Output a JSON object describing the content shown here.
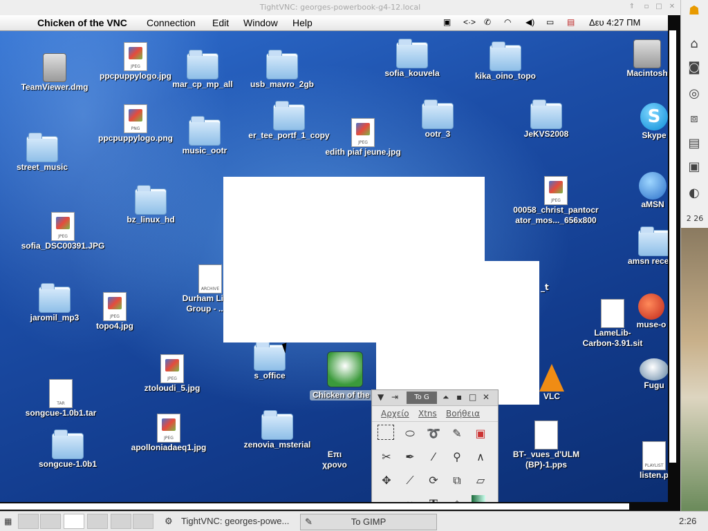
{
  "window": {
    "title": "TightVNC: georges-powerbook-g4-12.local"
  },
  "menubar": {
    "app_name": "Chicken of the VNC",
    "items": [
      "Connection",
      "Edit",
      "Window",
      "Help"
    ],
    "clock": "Δευ 4:27 ΠΜ"
  },
  "desktop_icons": [
    {
      "label": "TeamViewer.dmg"
    },
    {
      "label": "ppcpuppylogo.jpg",
      "badge": "JPEG"
    },
    {
      "label": "mar_cp_mp_all"
    },
    {
      "label": "usb_mavro_2gb"
    },
    {
      "label": "sofia_kouvela"
    },
    {
      "label": "kika_oino_topo"
    },
    {
      "label": "Macintosh"
    },
    {
      "label": "ppcpuppylogo.png",
      "badge": "PNG"
    },
    {
      "label": "music_ootr"
    },
    {
      "label": "er_tee_portf_1_copy"
    },
    {
      "label": "edith piaf jeune.jpg",
      "badge": "JPEG"
    },
    {
      "label": "ootr_3"
    },
    {
      "label": "JeKVS2008"
    },
    {
      "label": "Skype"
    },
    {
      "label": "street_music"
    },
    {
      "label": "bz_linux_hd"
    },
    {
      "label": "00058_christ_pantocr",
      "label2": "ator_mos..._656x800",
      "badge": "JPEG"
    },
    {
      "label": "aMSN"
    },
    {
      "label": "sofia_DSC00391.JPG",
      "badge": "JPEG"
    },
    {
      "label": "Durham Linux",
      "label2": "Group - ...Pr",
      "badge": "ARCHIVE"
    },
    {
      "label": "amsn receive"
    },
    {
      "label": "jaromil_mp3"
    },
    {
      "label": "topo4.jpg",
      "badge": "JPEG"
    },
    {
      "label": "LameLib-",
      "label2": "Carbon-3.91.sit"
    },
    {
      "label": "muse-o"
    },
    {
      "label": "s_office"
    },
    {
      "label": "Chicken of the V"
    },
    {
      "label": "Fugu"
    },
    {
      "label": "songcue-1.0b1.tar",
      "badge": "TAR"
    },
    {
      "label": "ztoloudi_5.jpg",
      "badge": "JPEG"
    },
    {
      "label": "VLC"
    },
    {
      "label": "songcue-1.0b1"
    },
    {
      "label": "apolloniadaeq1.jpg",
      "badge": "JPEG"
    },
    {
      "label": "zenovia_msterial"
    },
    {
      "label": "Επι",
      "label2": "χρονο"
    },
    {
      "label": "BT-_vues_d'ULM",
      "label2": "(BP)-1.pps"
    },
    {
      "label": "listen.p",
      "badge": "PLAYLIST"
    },
    {
      "label": "_t"
    }
  ],
  "gimp": {
    "title_button": "To G",
    "menu": [
      "Αρχείο",
      "Xtns",
      "Βοήθεια"
    ],
    "tools": [
      "rect-select",
      "ellipse-select",
      "lasso",
      "fuzzy-select",
      "color-select",
      "scissors",
      "paths",
      "color-picker",
      "zoom",
      "measure",
      "move",
      "crop",
      "rotate",
      "scale",
      "shear",
      "perspective",
      "flip",
      "text",
      "bucket-fill",
      "blend"
    ]
  },
  "taskbar": {
    "tasks": [
      "TightVNC: georges-powe...",
      "To GIMP"
    ],
    "clock": "2:26"
  },
  "right_panel": {
    "indicator": "2 26"
  },
  "colors": {
    "desktop_blue": "#1c4ea8",
    "vlc_orange": "#f08c14"
  }
}
